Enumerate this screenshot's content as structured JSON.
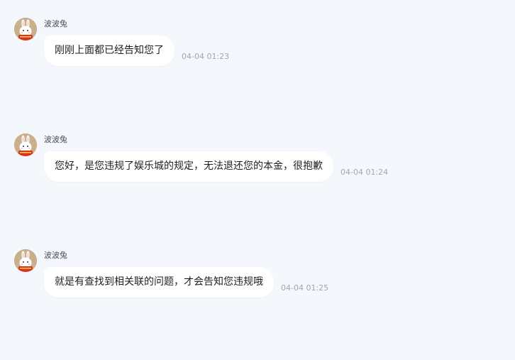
{
  "messages": [
    {
      "sender": "波波兔",
      "text": "刚刚上面都已经告知您了",
      "time": "04-04 01:23"
    },
    {
      "sender": "波波兔",
      "text": "您好，是您违规了娱乐城的规定，无法退还您的本金，很抱歉",
      "time": "04-04 01:24"
    },
    {
      "sender": "波波兔",
      "text": "就是有查找到相关联的问题，才会告知您违规哦",
      "time": "04-04 01:25"
    }
  ],
  "colors": {
    "background": "#f4f7fb",
    "bubble": "#ffffff",
    "avatar_bg": "#c7b08b",
    "avatar_accent": "#d8331f",
    "time_text": "#a3a7ad"
  },
  "icons": {
    "avatar": "bunny-avatar-icon"
  }
}
